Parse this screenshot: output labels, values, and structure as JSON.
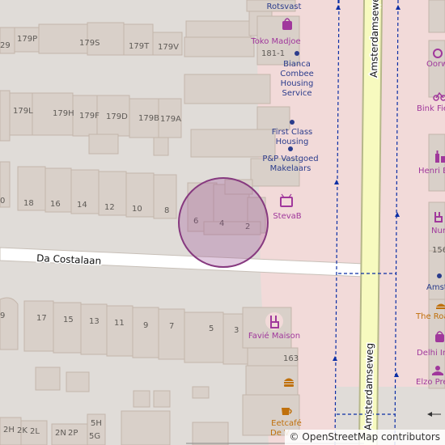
{
  "map": {
    "streets": {
      "da_costalaan": "Da Costalaan",
      "amsterdamseweg_north": "Amsterdamseweg",
      "amsterdamseweg_south": "Amsterdamseweg"
    },
    "house_numbers": {
      "h29": "29",
      "h179P": "179P",
      "h179S": "179S",
      "h179T": "179T",
      "h179V": "179V",
      "h179L": "179L",
      "h179H": "179H",
      "h179F": "179F",
      "h179D": "179D",
      "h179B": "179B",
      "h179A": "179A",
      "h181_1": "181-1",
      "h18": "18",
      "h16": "16",
      "h14": "14",
      "h12": "12",
      "h10": "10",
      "h8": "8",
      "h6": "6",
      "h4": "4",
      "h2": "2",
      "h0": "0",
      "h9a": "9",
      "h17": "17",
      "h15": "15",
      "h13": "13",
      "h11": "11",
      "h9": "9",
      "h7": "7",
      "h5": "5",
      "h3": "3",
      "h163": "163",
      "h156": "156",
      "h2H": "2H",
      "h2K": "2K",
      "h2L": "2L",
      "h2N": "2N",
      "h2P": "2P",
      "h5H": "5H",
      "h5G": "5G"
    },
    "pois": {
      "rotsvast": "Rotsvast",
      "toko_madjoe": "Toko Madjoe",
      "bianca_l1": "Bianca",
      "bianca_l2": "Combee",
      "bianca_l3": "Housing",
      "bianca_l4": "Service",
      "first_class_l1": "First Class",
      "first_class_l2": "Housing",
      "pp_l1": "P&P Vastgoed",
      "pp_l2": "Makelaars",
      "steva": "StevaB",
      "favie": "Favié Maison",
      "eetcafe_l1": "Eetcafé",
      "eetcafe_l2": "De V",
      "oorw": "Oorw",
      "bink": "Bink Fie",
      "henri": "Henri B",
      "nur": "Nur",
      "amst": "Amst",
      "roas": "The Roa",
      "delhi": "Delhi In",
      "elzo": "Elzo Pre"
    }
  },
  "attribution": {
    "symbol": "©",
    "text": "OpenStreetMap contributors"
  },
  "marker": {
    "type": "location-radius-circle",
    "color": "#9b4f96"
  },
  "colors": {
    "background": "#e0dcd8",
    "building": "#d9d0c9",
    "building_stroke": "#c4b6ab",
    "commercial": "#f2dad9",
    "road_primary": "#f7fabf",
    "road_primary_casing": "#b6b88a",
    "footway": "#0b2ea5",
    "poi": "#a0389c"
  }
}
